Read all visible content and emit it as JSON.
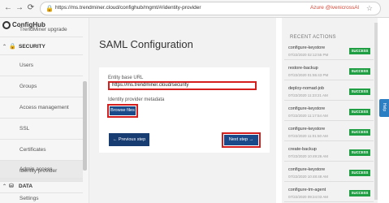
{
  "browser": {
    "back_icon": "←",
    "forward_icon": "→",
    "reload_icon": "⟳",
    "url": "https://ms.trendminer.cloud/confighub/mgmt/#/identity-provider",
    "tenant": "Azure @ivenicrossAl"
  },
  "sidebar": {
    "app_name": "ConfigHub",
    "items_top": [
      {
        "label": "TrendMiner upgrade"
      }
    ],
    "security_group": {
      "label": "SECURITY",
      "chevron": "⌃"
    },
    "security_items": [
      {
        "label": "Users"
      },
      {
        "label": "Groups"
      },
      {
        "label": "Access management"
      },
      {
        "label": "SSL"
      },
      {
        "label": "Certificates"
      },
      {
        "label": "Identity provider"
      },
      {
        "label": "Admin access"
      }
    ],
    "data_group": {
      "label": "DATA",
      "chevron": "⌃"
    },
    "data_items": [
      {
        "label": "Settings"
      }
    ]
  },
  "main": {
    "title": "SAML Configuration",
    "entity_label": "Entity base URL",
    "entity_value": "https://ms.trendminer.cloud/security",
    "metadata_label": "Identity provider metadata",
    "browse_label": "Browse files",
    "prev_label": "Previous step",
    "next_label": "Next step"
  },
  "recent": {
    "title": "RECENT ACTIONS",
    "actions": [
      {
        "name": "configure-keystore",
        "time": "07/22/2020 02:12:55 PM",
        "status": "SUCCESS"
      },
      {
        "name": "restore-backup",
        "time": "07/22/2020 01:55:43 PM",
        "status": "SUCCESS"
      },
      {
        "name": "deploy-nomad-job",
        "time": "07/22/2020 11:23:21 AM",
        "status": "SUCCESS"
      },
      {
        "name": "configure-keystore",
        "time": "07/22/2020 11:17:54 AM",
        "status": "SUCCESS"
      },
      {
        "name": "configure-keystore",
        "time": "07/22/2020 11:01:50 AM",
        "status": "SUCCESS"
      },
      {
        "name": "create-backup",
        "time": "07/22/2020 10:49:26 AM",
        "status": "SUCCESS"
      },
      {
        "name": "configure-keystore",
        "time": "07/22/2020 10:48:48 AM",
        "status": "SUCCESS"
      },
      {
        "name": "configure-tm-agent",
        "time": "07/22/2020 09:24:03 AM",
        "status": "SUCCESS"
      }
    ]
  },
  "help_label": "Help",
  "colors": {
    "accent": "#1a4a8a",
    "highlight": "#d51f1f",
    "success": "#1f9e43"
  }
}
